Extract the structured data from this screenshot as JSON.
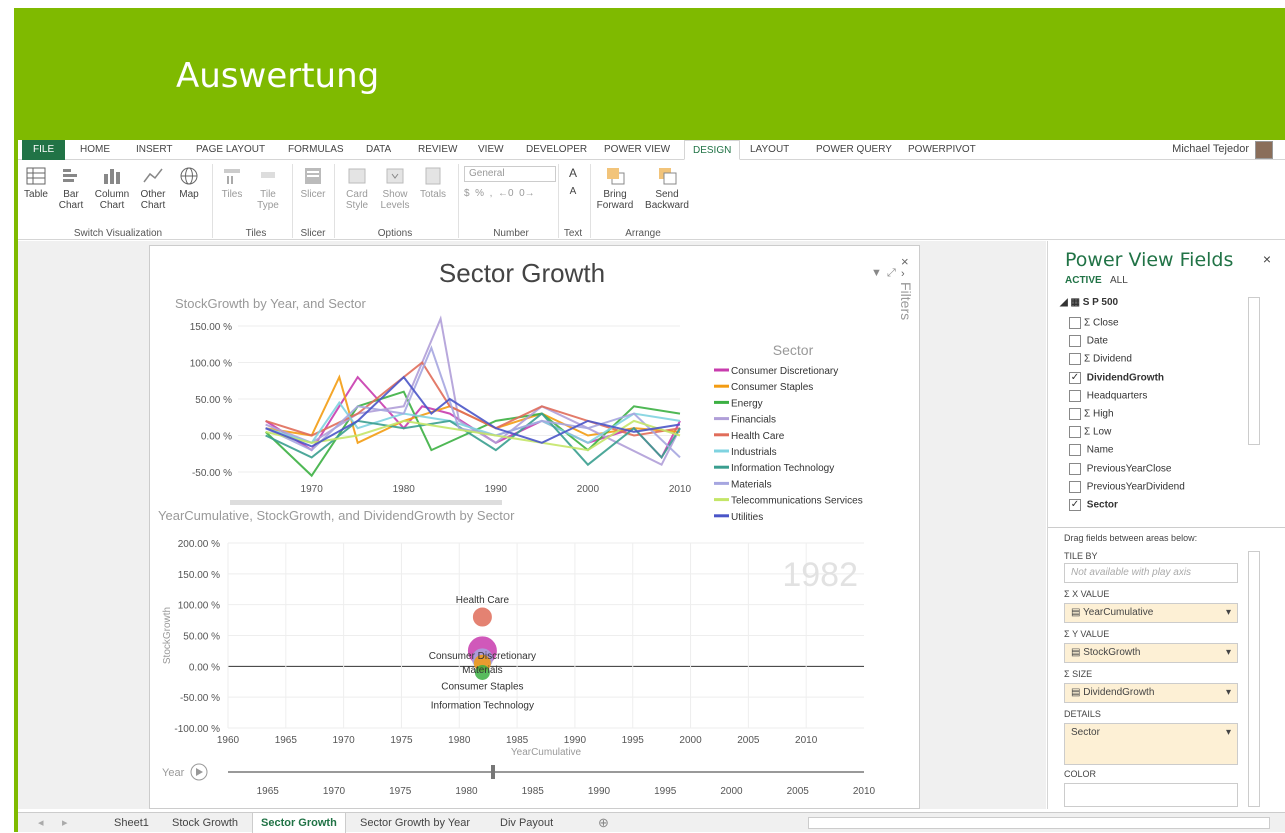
{
  "slide": {
    "title": "Auswertung",
    "accent": "#7fba00"
  },
  "ribbon_tabs": [
    "FILE",
    "HOME",
    "INSERT",
    "PAGE LAYOUT",
    "FORMULAS",
    "DATA",
    "REVIEW",
    "VIEW",
    "DEVELOPER",
    "POWER VIEW",
    "DESIGN",
    "LAYOUT",
    "POWER QUERY",
    "POWERPIVOT"
  ],
  "active_tab": "DESIGN",
  "user": "Michael Tejedor",
  "ribbon": {
    "switch_viz": {
      "group": "Switch Visualization",
      "buttons": [
        "Table",
        "Bar Chart",
        "Column Chart",
        "Other Chart",
        "Map"
      ]
    },
    "tiles": {
      "group": "Tiles",
      "buttons": [
        "Tiles",
        "Tile Type"
      ]
    },
    "slicer": {
      "group": "Slicer",
      "buttons": [
        "Slicer"
      ]
    },
    "options": {
      "group": "Options",
      "buttons": [
        "Card Style",
        "Show Levels",
        "Totals"
      ]
    },
    "number": {
      "group": "Number",
      "format": "General"
    },
    "text": {
      "group": "Text"
    },
    "arrange": {
      "group": "Arrange",
      "buttons": [
        "Bring Forward",
        "Send Backward"
      ]
    }
  },
  "report": {
    "title": "Sector Growth",
    "filters_label": "Filters",
    "chart1_title": "StockGrowth by Year, and Sector",
    "chart2_title": "YearCumulative, StockGrowth, and DividendGrowth by Sector",
    "play_year": "1982",
    "play_label": "Year"
  },
  "chart_data": [
    {
      "type": "line",
      "title": "StockGrowth by Year, and Sector",
      "legend_title": "Sector",
      "legend_position": "right",
      "xlim": [
        1962,
        2010
      ],
      "ylim": [
        -50,
        150
      ],
      "yticks": [
        "150.00 %",
        "100.00 %",
        "50.00 %",
        "0.00 %",
        "-50.00 %"
      ],
      "xticks": [
        "1970",
        "1980",
        "1990",
        "2000",
        "2010"
      ],
      "series": [
        {
          "name": "Consumer Discretionary",
          "color": "#c83cae",
          "values": [
            {
              "x": 1965,
              "y": 20
            },
            {
              "x": 1970,
              "y": -20
            },
            {
              "x": 1975,
              "y": 80
            },
            {
              "x": 1980,
              "y": 10
            },
            {
              "x": 1982,
              "y": 40
            },
            {
              "x": 1985,
              "y": 30
            },
            {
              "x": 1990,
              "y": -10
            },
            {
              "x": 1995,
              "y": 20
            },
            {
              "x": 2000,
              "y": -10
            },
            {
              "x": 2005,
              "y": 10
            },
            {
              "x": 2008,
              "y": -30
            },
            {
              "x": 2010,
              "y": 20
            }
          ]
        },
        {
          "name": "Consumer Staples",
          "color": "#f39c12",
          "values": [
            {
              "x": 1965,
              "y": 10
            },
            {
              "x": 1970,
              "y": 0
            },
            {
              "x": 1973,
              "y": 80
            },
            {
              "x": 1975,
              "y": -10
            },
            {
              "x": 1980,
              "y": 20
            },
            {
              "x": 1985,
              "y": 40
            },
            {
              "x": 1990,
              "y": 10
            },
            {
              "x": 1995,
              "y": 30
            },
            {
              "x": 2000,
              "y": 0
            },
            {
              "x": 2005,
              "y": 10
            },
            {
              "x": 2010,
              "y": 5
            }
          ]
        },
        {
          "name": "Energy",
          "color": "#3cb043",
          "values": [
            {
              "x": 1965,
              "y": 5
            },
            {
              "x": 1970,
              "y": -55
            },
            {
              "x": 1975,
              "y": 40
            },
            {
              "x": 1980,
              "y": 60
            },
            {
              "x": 1983,
              "y": -20
            },
            {
              "x": 1990,
              "y": 20
            },
            {
              "x": 1995,
              "y": 30
            },
            {
              "x": 2000,
              "y": -20
            },
            {
              "x": 2005,
              "y": 40
            },
            {
              "x": 2010,
              "y": 30
            }
          ]
        },
        {
          "name": "Financials",
          "color": "#b09fd8",
          "values": [
            {
              "x": 1965,
              "y": 15
            },
            {
              "x": 1970,
              "y": -10
            },
            {
              "x": 1975,
              "y": 30
            },
            {
              "x": 1980,
              "y": 40
            },
            {
              "x": 1984,
              "y": 160
            },
            {
              "x": 1986,
              "y": 20
            },
            {
              "x": 1990,
              "y": -10
            },
            {
              "x": 1995,
              "y": 40
            },
            {
              "x": 2000,
              "y": 10
            },
            {
              "x": 2008,
              "y": -40
            },
            {
              "x": 2010,
              "y": 10
            }
          ]
        },
        {
          "name": "Health Care",
          "color": "#e06d5a",
          "values": [
            {
              "x": 1965,
              "y": 20
            },
            {
              "x": 1970,
              "y": 0
            },
            {
              "x": 1975,
              "y": 30
            },
            {
              "x": 1982,
              "y": 100
            },
            {
              "x": 1985,
              "y": 40
            },
            {
              "x": 1990,
              "y": 10
            },
            {
              "x": 1995,
              "y": 40
            },
            {
              "x": 2000,
              "y": 20
            },
            {
              "x": 2005,
              "y": 0
            },
            {
              "x": 2010,
              "y": 10
            }
          ]
        },
        {
          "name": "Industrials",
          "color": "#7fd3e0",
          "values": [
            {
              "x": 1965,
              "y": 10
            },
            {
              "x": 1970,
              "y": -10
            },
            {
              "x": 1973,
              "y": 45
            },
            {
              "x": 1975,
              "y": 10
            },
            {
              "x": 1980,
              "y": 30
            },
            {
              "x": 1985,
              "y": 20
            },
            {
              "x": 1990,
              "y": 0
            },
            {
              "x": 1995,
              "y": 20
            },
            {
              "x": 2000,
              "y": -10
            },
            {
              "x": 2005,
              "y": 30
            },
            {
              "x": 2010,
              "y": 20
            }
          ]
        },
        {
          "name": "Information Technology",
          "color": "#3a9e8f",
          "values": [
            {
              "x": 1965,
              "y": 0
            },
            {
              "x": 1970,
              "y": -30
            },
            {
              "x": 1975,
              "y": 20
            },
            {
              "x": 1980,
              "y": 10
            },
            {
              "x": 1985,
              "y": 20
            },
            {
              "x": 1990,
              "y": -20
            },
            {
              "x": 1995,
              "y": 30
            },
            {
              "x": 2000,
              "y": -40
            },
            {
              "x": 2005,
              "y": 10
            },
            {
              "x": 2008,
              "y": -30
            },
            {
              "x": 2010,
              "y": 10
            }
          ]
        },
        {
          "name": "Materials",
          "color": "#a6a6e0",
          "values": [
            {
              "x": 1965,
              "y": 10
            },
            {
              "x": 1970,
              "y": -20
            },
            {
              "x": 1975,
              "y": 40
            },
            {
              "x": 1980,
              "y": 30
            },
            {
              "x": 1983,
              "y": 120
            },
            {
              "x": 1986,
              "y": 10
            },
            {
              "x": 1990,
              "y": 0
            },
            {
              "x": 1995,
              "y": 20
            },
            {
              "x": 2000,
              "y": 10
            },
            {
              "x": 2005,
              "y": 30
            },
            {
              "x": 2010,
              "y": -30
            }
          ]
        },
        {
          "name": "Telecommunications Services",
          "color": "#c4e668",
          "values": [
            {
              "x": 1965,
              "y": 5
            },
            {
              "x": 1970,
              "y": -10
            },
            {
              "x": 1975,
              "y": 0
            },
            {
              "x": 1980,
              "y": 20
            },
            {
              "x": 1985,
              "y": 10
            },
            {
              "x": 1990,
              "y": 0
            },
            {
              "x": 1995,
              "y": -10
            },
            {
              "x": 2000,
              "y": -20
            },
            {
              "x": 2005,
              "y": 20
            },
            {
              "x": 2010,
              "y": 0
            }
          ]
        },
        {
          "name": "Utilities",
          "color": "#4a55c8",
          "values": [
            {
              "x": 1965,
              "y": 10
            },
            {
              "x": 1970,
              "y": -15
            },
            {
              "x": 1975,
              "y": 20
            },
            {
              "x": 1980,
              "y": 80
            },
            {
              "x": 1983,
              "y": 30
            },
            {
              "x": 1985,
              "y": 50
            },
            {
              "x": 1990,
              "y": 10
            },
            {
              "x": 1995,
              "y": -10
            },
            {
              "x": 2000,
              "y": 20
            },
            {
              "x": 2005,
              "y": 5
            },
            {
              "x": 2010,
              "y": 15
            }
          ]
        }
      ]
    },
    {
      "type": "scatter",
      "title": "YearCumulative, StockGrowth, and DividendGrowth by Sector",
      "xlabel": "YearCumulative",
      "ylabel": "StockGrowth",
      "xlim": [
        1960,
        2015
      ],
      "ylim": [
        -100,
        200
      ],
      "yticks": [
        "200.00 %",
        "150.00 %",
        "100.00 %",
        "50.00 %",
        "0.00 %",
        "-50.00 %",
        "-100.00 %"
      ],
      "xticks": [
        "1960",
        "1965",
        "1970",
        "1975",
        "1980",
        "1985",
        "1990",
        "1995",
        "2000",
        "2005",
        "2010"
      ],
      "points": [
        {
          "label": "Health Care",
          "x": 1982,
          "y": 80,
          "size": 9,
          "color": "#e06d5a"
        },
        {
          "label": "Consumer Discretionary",
          "x": 1982,
          "y": 25,
          "size": 14,
          "color": "#c83cae"
        },
        {
          "label": "Materials",
          "x": 1982,
          "y": 12,
          "size": 10,
          "color": "#a6a6e0"
        },
        {
          "label": "Consumer Staples",
          "x": 1982,
          "y": 5,
          "size": 8,
          "color": "#f39c12"
        },
        {
          "label": "Information Technology",
          "x": 1982,
          "y": -10,
          "size": 7,
          "color": "#3cb043"
        }
      ]
    }
  ],
  "play_axis": {
    "ticks": [
      "1965",
      "1970",
      "1975",
      "1980",
      "1985",
      "1990",
      "1995",
      "2000",
      "2005",
      "2010"
    ],
    "value": 1982,
    "min": 1962,
    "max": 2010
  },
  "fields_panel": {
    "title": "Power View Fields",
    "tab_active": "ACTIVE",
    "tab_all": "ALL",
    "table": "S P 500",
    "fields": [
      {
        "name": "Close",
        "sigma": true,
        "checked": false
      },
      {
        "name": "Date",
        "sigma": false,
        "checked": false
      },
      {
        "name": "Dividend",
        "sigma": true,
        "checked": false
      },
      {
        "name": "DividendGrowth",
        "sigma": false,
        "checked": true,
        "bold": true
      },
      {
        "name": "Headquarters",
        "sigma": false,
        "checked": false
      },
      {
        "name": "High",
        "sigma": true,
        "checked": false
      },
      {
        "name": "Low",
        "sigma": true,
        "checked": false
      },
      {
        "name": "Name",
        "sigma": false,
        "checked": false
      },
      {
        "name": "PreviousYearClose",
        "sigma": false,
        "checked": false
      },
      {
        "name": "PreviousYearDividend",
        "sigma": false,
        "checked": false
      },
      {
        "name": "Sector",
        "sigma": false,
        "checked": true,
        "bold": true
      }
    ],
    "drag_hint": "Drag fields between areas below:",
    "tile_by_label": "TILE BY",
    "tile_by_placeholder": "Not available with play axis",
    "x_label": "Σ X VALUE",
    "x_value": "YearCumulative",
    "y_label": "Σ Y VALUE",
    "y_value": "StockGrowth",
    "size_label": "Σ SIZE",
    "size_value": "DividendGrowth",
    "details_label": "DETAILS",
    "details_value": "Sector",
    "color_label": "COLOR"
  },
  "sheet_tabs": [
    "Sheet1",
    "Stock Growth",
    "Sector Growth",
    "Sector Growth by Year",
    "Div Payout"
  ],
  "active_sheet": "Sector Growth"
}
